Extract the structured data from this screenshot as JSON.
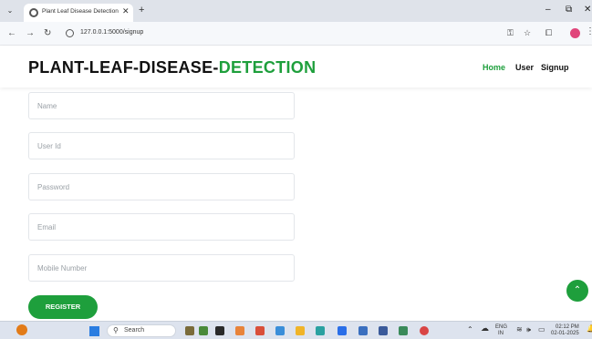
{
  "browser": {
    "tab_title": "Plant Leaf Disease Detection",
    "url": "127.0.0.1:5000/signup"
  },
  "site": {
    "brand_main": "PLANT-LEAF-DISEASE-",
    "brand_accent": "DETECTION",
    "nav": [
      {
        "label": "Home",
        "active": true
      },
      {
        "label": "User",
        "active": false
      },
      {
        "label": "Signup",
        "active": false
      }
    ]
  },
  "form": {
    "fields": [
      {
        "placeholder": "Name",
        "value": ""
      },
      {
        "placeholder": "User Id",
        "value": ""
      },
      {
        "placeholder": "Password",
        "value": ""
      },
      {
        "placeholder": "Email",
        "value": ""
      },
      {
        "placeholder": "Mobile Number",
        "value": ""
      }
    ],
    "submit_label": "REGISTER"
  },
  "taskbar": {
    "search_label": "Search",
    "lang_line1": "ENG",
    "lang_line2": "IN",
    "time": "02:12 PM",
    "date": "02-01-2025"
  },
  "colors": {
    "accent": "#1e9f3c",
    "brand_text": "#111111"
  },
  "icons": [
    "back-icon",
    "forward-icon",
    "reload-icon",
    "site-info-icon",
    "star-icon",
    "extensions-icon",
    "scroll-to-top-icon",
    "search-icon",
    "start-icon"
  ]
}
